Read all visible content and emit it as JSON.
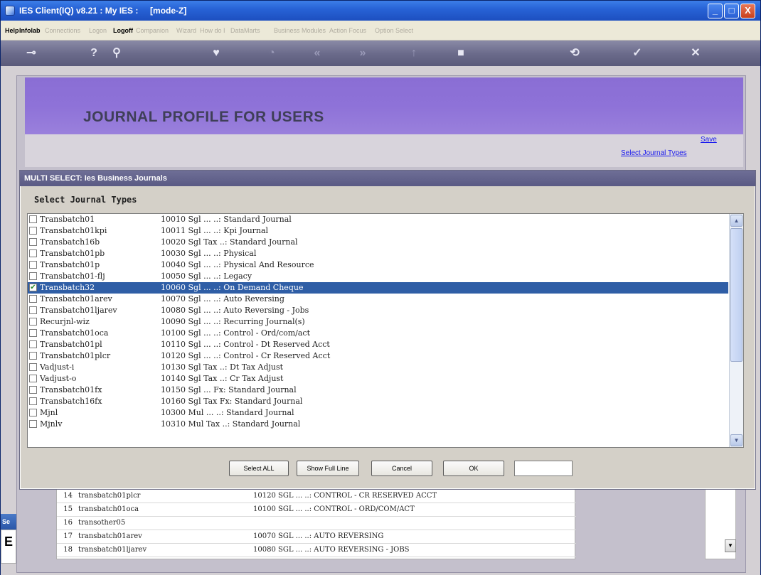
{
  "window": {
    "title": "IES Client(IQ) v8.21 : My IES :     [mode-Z]",
    "min_label": "_",
    "max_label": "□",
    "close_label": "X"
  },
  "menu": [
    {
      "label": "Help",
      "active": true
    },
    {
      "label": "Infolab",
      "active": true
    },
    {
      "label": "Connections",
      "active": false
    },
    {
      "label": "Logon",
      "active": false
    },
    {
      "label": "Logoff",
      "active": true
    },
    {
      "label": "Companion",
      "active": false
    },
    {
      "label": "Wizard",
      "active": false
    },
    {
      "label": "How do I",
      "active": false
    },
    {
      "label": "DataMarts",
      "active": false
    },
    {
      "label": "Business Modules",
      "active": false
    },
    {
      "label": "Action Focus",
      "active": false
    },
    {
      "label": "Option Select",
      "active": false
    }
  ],
  "toolbar": {
    "buttons": [
      {
        "name": "key-icon",
        "glyph": "⊸"
      },
      {
        "name": "help-icon",
        "glyph": "?"
      },
      {
        "name": "search-icon",
        "glyph": "⚲"
      },
      {
        "name": "heart-icon",
        "glyph": "♥"
      },
      {
        "name": "clock-icon",
        "glyph": "◔"
      },
      {
        "name": "rewind-icon",
        "glyph": "«"
      },
      {
        "name": "forward-icon",
        "glyph": "»"
      },
      {
        "name": "up-icon",
        "glyph": "↑"
      },
      {
        "name": "stop-icon",
        "glyph": "■"
      },
      {
        "name": "refresh-icon",
        "glyph": "⟲"
      },
      {
        "name": "check-icon",
        "glyph": "✓"
      },
      {
        "name": "close-icon",
        "glyph": "✕"
      }
    ]
  },
  "page": {
    "title": "JOURNAL PROFILE FOR USERS",
    "links": {
      "save": "Save",
      "select_journal_types": "Select Journal Types"
    }
  },
  "dialog": {
    "title": "MULTI SELECT: Ies Business Journals",
    "heading": "Select Journal Types",
    "rows": [
      {
        "name": "Transbatch01",
        "desc": "10010 Sgl ... ..: Standard Journal",
        "checked": false,
        "selected": false
      },
      {
        "name": "Transbatch01kpi",
        "desc": "10011 Sgl ... ..: Kpi Journal",
        "checked": false,
        "selected": false
      },
      {
        "name": "Transbatch16b",
        "desc": "10020 Sgl Tax ..: Standard Journal",
        "checked": false,
        "selected": false
      },
      {
        "name": "Transbatch01pb",
        "desc": "10030 Sgl ... ..: Physical",
        "checked": false,
        "selected": false
      },
      {
        "name": "Transbatch01p",
        "desc": "10040 Sgl ... ..: Physical And Resource",
        "checked": false,
        "selected": false
      },
      {
        "name": "Transbatch01-flj",
        "desc": "10050 Sgl ... ..: Legacy",
        "checked": false,
        "selected": false
      },
      {
        "name": "Transbatch32",
        "desc": "10060 Sgl ... ..: On Demand Cheque",
        "checked": true,
        "selected": true
      },
      {
        "name": "Transbatch01arev",
        "desc": "10070 Sgl ... ..: Auto Reversing",
        "checked": false,
        "selected": false
      },
      {
        "name": "Transbatch01ljarev",
        "desc": "10080 Sgl ... ..: Auto Reversing - Jobs",
        "checked": false,
        "selected": false
      },
      {
        "name": "Recurjnl-wiz",
        "desc": "10090 Sgl ... ..: Recurring Journal(s)",
        "checked": false,
        "selected": false
      },
      {
        "name": "Transbatch01oca",
        "desc": "10100 Sgl ... ..: Control - Ord/com/act",
        "checked": false,
        "selected": false
      },
      {
        "name": "Transbatch01pl",
        "desc": "10110 Sgl ... ..: Control - Dt Reserved Acct",
        "checked": false,
        "selected": false
      },
      {
        "name": "Transbatch01plcr",
        "desc": "10120 Sgl ... ..: Control - Cr Reserved Acct",
        "checked": false,
        "selected": false
      },
      {
        "name": "Vadjust-i",
        "desc": "10130 Sgl Tax ..: Dt Tax Adjust",
        "checked": false,
        "selected": false
      },
      {
        "name": "Vadjust-o",
        "desc": "10140 Sgl Tax ..: Cr Tax Adjust",
        "checked": false,
        "selected": false
      },
      {
        "name": "Transbatch01fx",
        "desc": "10150 Sgl ... Fx: Standard Journal",
        "checked": false,
        "selected": false
      },
      {
        "name": "Transbatch16fx",
        "desc": "10160 Sgl Tax Fx: Standard Journal",
        "checked": false,
        "selected": false
      },
      {
        "name": "Mjnl",
        "desc": "10300 Mul ... ..: Standard Journal",
        "checked": false,
        "selected": false
      },
      {
        "name": "Mjnlv",
        "desc": "10310 Mul Tax ..: Standard Journal",
        "checked": false,
        "selected": false
      }
    ],
    "buttons": {
      "select_all": "Select ALL",
      "show_full_line": "Show Full Line",
      "cancel": "Cancel",
      "ok": "OK"
    },
    "input_value": ""
  },
  "background_list": [
    {
      "num": "14",
      "name": "transbatch01plcr",
      "desc": "10120 SGL ... ..: CONTROL - CR RESERVED ACCT"
    },
    {
      "num": "15",
      "name": "transbatch01oca",
      "desc": "10100 SGL ... ..: CONTROL - ORD/COM/ACT"
    },
    {
      "num": "16",
      "name": "transother05",
      "desc": ""
    },
    {
      "num": "17",
      "name": "transbatch01arev",
      "desc": "10070 SGL ... ..: AUTO REVERSING"
    },
    {
      "num": "18",
      "name": "transbatch01ljarev",
      "desc": "10080 SGL ... ..: AUTO REVERSING - JOBS"
    }
  ],
  "side": {
    "tab_label": "Se",
    "box_label": "E"
  }
}
